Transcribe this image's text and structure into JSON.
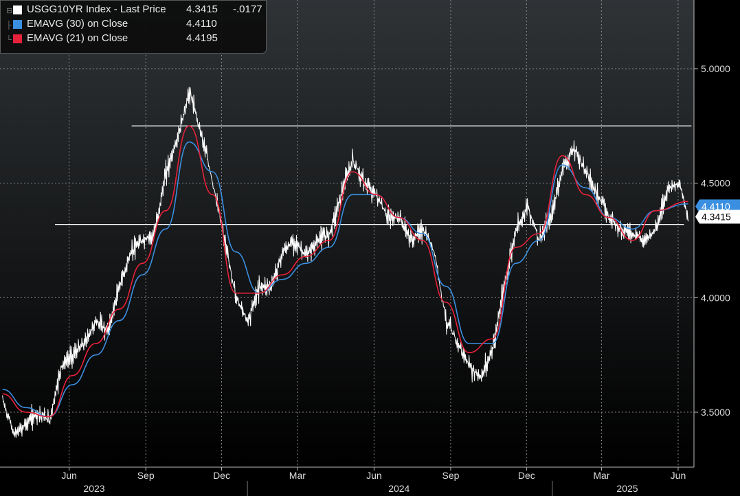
{
  "legend": {
    "main": {
      "name": "USGG10YR Index - Last Price",
      "value": "4.3415",
      "change": "-.0177",
      "color": "#ffffff"
    },
    "ema30": {
      "name": "EMAVG (30)  on Close",
      "value": "4.4110",
      "color": "#3b8fe0"
    },
    "ema21": {
      "name": "EMAVG (21)  on Close",
      "value": "4.4195",
      "color": "#e8213a"
    }
  },
  "price_tags": {
    "ema21": "4.4195",
    "ema30": "4.4110",
    "last": "4.3415"
  },
  "chart_data": {
    "type": "line",
    "title": "",
    "y_axis": {
      "position": "right",
      "ticks": [
        "5.0000",
        "4.5000",
        "4.0000",
        "3.5000"
      ],
      "tick_values": [
        5.0,
        4.5,
        4.0,
        3.5
      ],
      "range": [
        3.26,
        5.3
      ]
    },
    "x_axis": {
      "ticks": [
        "Jun",
        "Sep",
        "Dec",
        "Mar",
        "Jun",
        "Sep",
        "Dec",
        "Mar",
        "Jun"
      ],
      "tick_dates": [
        "2023-06-01",
        "2023-09-01",
        "2023-12-01",
        "2024-03-01",
        "2024-06-01",
        "2024-09-01",
        "2024-12-01",
        "2025-03-01",
        "2025-06-01"
      ],
      "years": [
        "2023",
        "2024",
        "2025"
      ],
      "year_dates": [
        "2023-07-01",
        "2024-07-01",
        "2025-04-01"
      ],
      "year_boundaries": [
        "2024-01-01",
        "2025-01-01"
      ],
      "range": [
        "2023-03-10",
        "2025-06-20"
      ]
    },
    "grid": true,
    "horizontal_lines": [
      {
        "value": 4.75,
        "start": "2023-08-15",
        "end": "2025-06-17",
        "color": "#ffffff"
      },
      {
        "value": 4.32,
        "start": "2023-05-15",
        "end": "2025-06-08",
        "color": "#ffffff"
      }
    ],
    "series": [
      {
        "name": "USGG10YR Index - Last Price",
        "style": "hilo-white",
        "x": [
          "2023-03-13",
          "2023-03-27",
          "2023-04-10",
          "2023-04-24",
          "2023-05-08",
          "2023-05-22",
          "2023-06-05",
          "2023-06-19",
          "2023-07-03",
          "2023-07-17",
          "2023-07-31",
          "2023-08-14",
          "2023-08-28",
          "2023-09-11",
          "2023-09-25",
          "2023-10-09",
          "2023-10-23",
          "2023-11-06",
          "2023-11-20",
          "2023-12-04",
          "2023-12-18",
          "2024-01-01",
          "2024-01-15",
          "2024-01-29",
          "2024-02-12",
          "2024-02-26",
          "2024-03-11",
          "2024-03-25",
          "2024-04-08",
          "2024-04-22",
          "2024-05-06",
          "2024-05-20",
          "2024-06-03",
          "2024-06-17",
          "2024-07-01",
          "2024-07-15",
          "2024-07-29",
          "2024-08-12",
          "2024-08-26",
          "2024-09-09",
          "2024-09-23",
          "2024-10-07",
          "2024-10-21",
          "2024-11-04",
          "2024-11-18",
          "2024-12-02",
          "2024-12-16",
          "2024-12-30",
          "2025-01-13",
          "2025-01-27",
          "2025-02-10",
          "2025-02-24",
          "2025-03-10",
          "2025-03-24",
          "2025-04-07",
          "2025-04-21",
          "2025-05-05",
          "2025-05-19",
          "2025-06-02",
          "2025-06-13"
        ],
        "y": [
          3.55,
          3.4,
          3.45,
          3.5,
          3.46,
          3.7,
          3.75,
          3.8,
          3.9,
          3.85,
          4.05,
          4.2,
          4.25,
          4.28,
          4.55,
          4.7,
          4.9,
          4.72,
          4.5,
          4.25,
          4.0,
          3.9,
          4.05,
          4.05,
          4.2,
          4.25,
          4.18,
          4.25,
          4.28,
          4.45,
          4.6,
          4.5,
          4.45,
          4.35,
          4.35,
          4.25,
          4.3,
          4.2,
          3.9,
          3.8,
          3.7,
          3.65,
          3.78,
          4.05,
          4.3,
          4.4,
          4.25,
          4.35,
          4.57,
          4.65,
          4.55,
          4.45,
          4.35,
          4.3,
          4.28,
          4.25,
          4.3,
          4.48,
          4.5,
          4.34
        ]
      },
      {
        "name": "EMAVG (30) on Close",
        "x": [
          "2023-03-13",
          "2023-04-10",
          "2023-05-08",
          "2023-06-05",
          "2023-07-03",
          "2023-07-31",
          "2023-08-28",
          "2023-09-25",
          "2023-10-23",
          "2023-11-20",
          "2023-12-18",
          "2024-01-15",
          "2024-02-12",
          "2024-03-11",
          "2024-04-08",
          "2024-05-06",
          "2024-06-03",
          "2024-07-01",
          "2024-07-29",
          "2024-08-26",
          "2024-09-23",
          "2024-10-21",
          "2024-11-18",
          "2024-12-16",
          "2025-01-13",
          "2025-02-10",
          "2025-03-10",
          "2025-04-07",
          "2025-05-05",
          "2025-06-13"
        ],
        "y": [
          3.6,
          3.52,
          3.48,
          3.62,
          3.75,
          3.9,
          4.1,
          4.3,
          4.68,
          4.55,
          4.2,
          4.02,
          4.08,
          4.15,
          4.22,
          4.45,
          4.45,
          4.35,
          4.28,
          4.05,
          3.8,
          3.8,
          4.15,
          4.25,
          4.58,
          4.48,
          4.35,
          4.3,
          4.38,
          4.41
        ]
      },
      {
        "name": "EMAVG (21) on Close",
        "x": [
          "2023-03-13",
          "2023-04-10",
          "2023-05-08",
          "2023-06-05",
          "2023-07-03",
          "2023-07-31",
          "2023-08-28",
          "2023-09-25",
          "2023-10-23",
          "2023-11-20",
          "2023-12-18",
          "2024-01-15",
          "2024-02-12",
          "2024-03-11",
          "2024-04-08",
          "2024-05-06",
          "2024-06-03",
          "2024-07-01",
          "2024-07-29",
          "2024-08-26",
          "2024-09-23",
          "2024-10-21",
          "2024-11-18",
          "2024-12-16",
          "2025-01-13",
          "2025-02-10",
          "2025-03-10",
          "2025-04-07",
          "2025-05-05",
          "2025-06-13"
        ],
        "y": [
          3.58,
          3.5,
          3.48,
          3.66,
          3.8,
          3.95,
          4.15,
          4.38,
          4.75,
          4.45,
          4.02,
          4.02,
          4.1,
          4.18,
          4.25,
          4.55,
          4.45,
          4.35,
          4.25,
          3.98,
          3.76,
          3.82,
          4.22,
          4.28,
          4.62,
          4.45,
          4.35,
          4.25,
          4.38,
          4.42
        ]
      }
    ]
  }
}
